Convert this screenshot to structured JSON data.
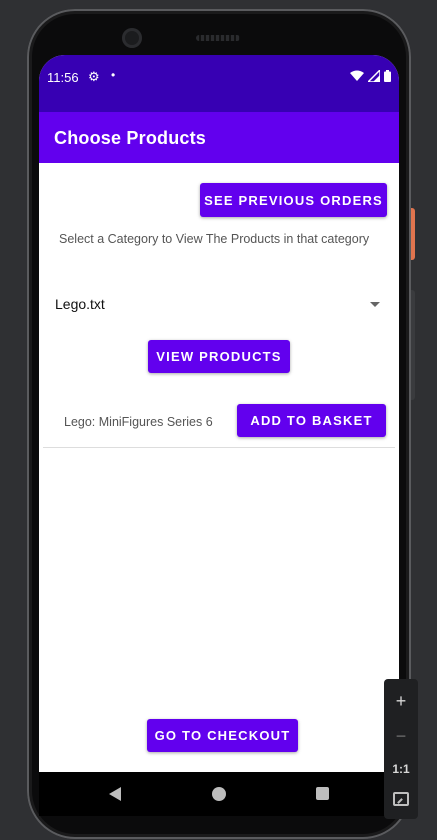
{
  "status_bar": {
    "time": "11:56",
    "gear_icon": "⚙",
    "notification_dot": "•",
    "wifi_icon": "wifi-icon",
    "signal_icon": "signal-icon",
    "battery_icon": "battery-icon"
  },
  "app_bar": {
    "title": "Choose Products"
  },
  "main": {
    "previous_orders_label": "SEE PREVIOUS ORDERS",
    "hint_text": "Select a Category to View The Products in that category",
    "category_spinner_value": "Lego.txt",
    "view_products_label": "VIEW PRODUCTS",
    "products": [
      {
        "name": "Lego: MiniFigures Series 6",
        "action_label": "ADD TO BASKET"
      }
    ],
    "checkout_label": "GO TO CHECKOUT"
  },
  "emulator_controls": {
    "zoom_in": "+",
    "zoom_out": "−",
    "one_to_one": "1:1"
  },
  "colors": {
    "status_bar": "#3700b3",
    "app_bar": "#6200ee",
    "button": "#6200ee"
  }
}
